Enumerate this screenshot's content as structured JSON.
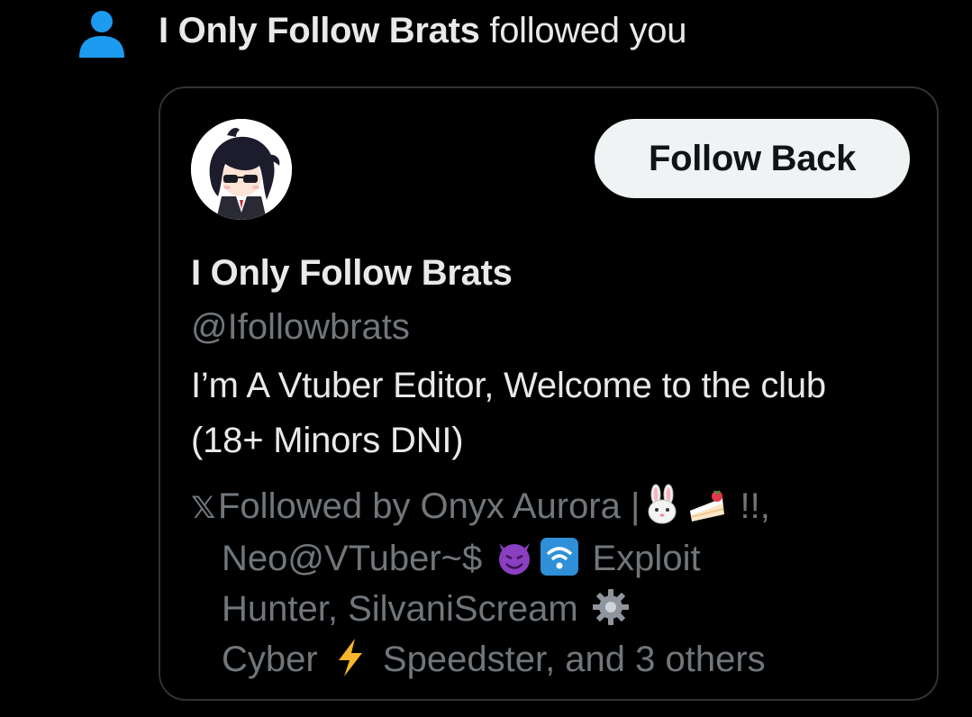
{
  "notification": {
    "actor_name": "I Only Follow Brats",
    "action_text": " followed you",
    "icon": "person-icon",
    "icon_color": "#1d9bf0"
  },
  "card": {
    "follow_button_label": "Follow Back",
    "display_name": "I Only Follow Brats",
    "handle": "@Ifollowbrats",
    "bio": "I’m A Vtuber Editor, Welcome to the club (18+ Minors DNI)",
    "followed_by": {
      "x_glyph": "𝕏",
      "line1_text": "Followed by Onyx Aurora |",
      "line1_tail": " !!,",
      "line2_text": "Neo@VTuber~$ ",
      "line2_tail": " Exploit",
      "line3_text": "Hunter, SilvaniScream ",
      "line4_text": "Cyber ",
      "line4_tail": " Speedster, and 3 others"
    },
    "emojis": [
      "rabbit-face-icon",
      "shortcake-icon",
      "smiling-devil-icon",
      "wifi-icon",
      "gear-icon",
      "lightning-icon"
    ]
  },
  "colors": {
    "background": "#000000",
    "primary_text": "#e7e9ea",
    "secondary_text": "#71767b",
    "border": "#2f3336",
    "button_bg": "#eff3f4",
    "button_text": "#0f1419",
    "accent": "#1d9bf0"
  }
}
